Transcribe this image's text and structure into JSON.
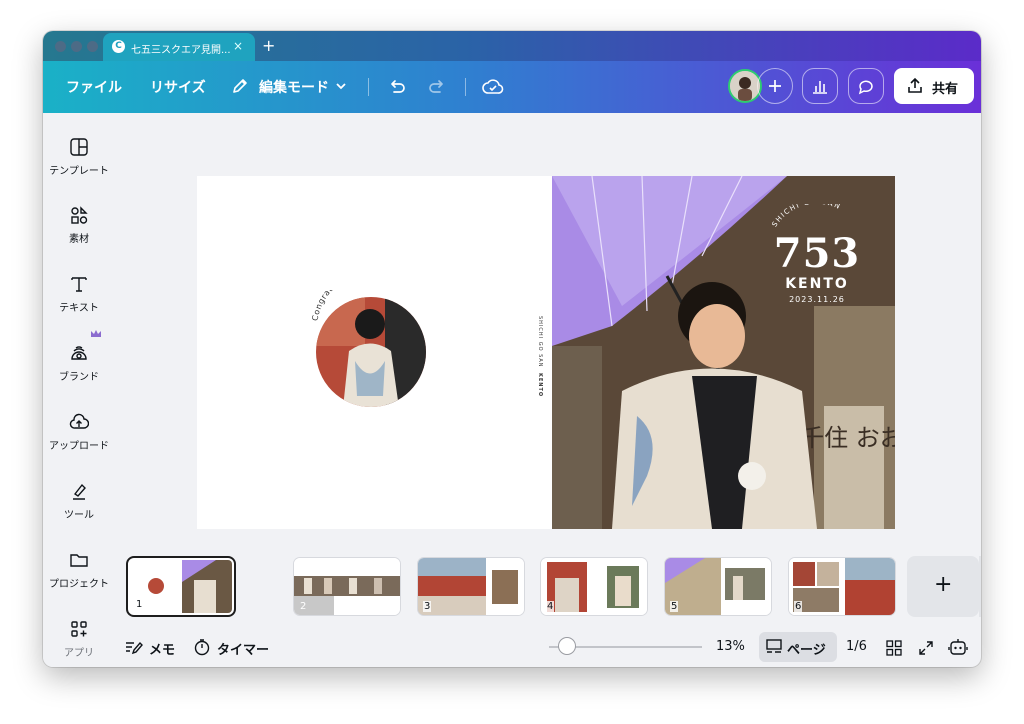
{
  "browser": {
    "tab_title": "七五三スクエア見開...",
    "tab_close": "×",
    "new_tab": "+"
  },
  "toolbar": {
    "file": "ファイル",
    "resize": "リサイズ",
    "edit_mode": "編集モード",
    "share": "共有"
  },
  "sidebar": {
    "items": [
      {
        "label": "テンプレート",
        "icon": "template-icon"
      },
      {
        "label": "素材",
        "icon": "elements-icon"
      },
      {
        "label": "テキスト",
        "icon": "text-icon"
      },
      {
        "label": "ブランド",
        "icon": "brand-icon"
      },
      {
        "label": "アップロード",
        "icon": "upload-icon"
      },
      {
        "label": "ツール",
        "icon": "tools-icon"
      },
      {
        "label": "プロジェクト",
        "icon": "folder-icon"
      },
      {
        "label": "アプリ",
        "icon": "apps-icon"
      }
    ]
  },
  "design": {
    "left_page": {
      "arc_text": "Congratulations!"
    },
    "right_page": {
      "side_text": "SHICHI GO SAN",
      "side_name": "KENTO",
      "arc_text": "SHICHI GO SAN",
      "big_number": "753",
      "name": "KENTO",
      "date": "2023.11.26",
      "sign_text": "千住 おお"
    }
  },
  "pages": {
    "thumbnails": [
      "1",
      "2",
      "3",
      "4",
      "5",
      "6"
    ],
    "selected": "1",
    "add": "+",
    "expand": "chevron-down-icon"
  },
  "footer": {
    "notes": "メモ",
    "timer": "タイマー",
    "zoom": "13%",
    "zoom_fraction": 0.13,
    "pages_label": "ページ",
    "page_count": "1/6"
  },
  "colors": {
    "accent_teal": "#1ab1c7",
    "accent_purple": "#6a30d8",
    "umbrella_purple": "#a98be6"
  }
}
